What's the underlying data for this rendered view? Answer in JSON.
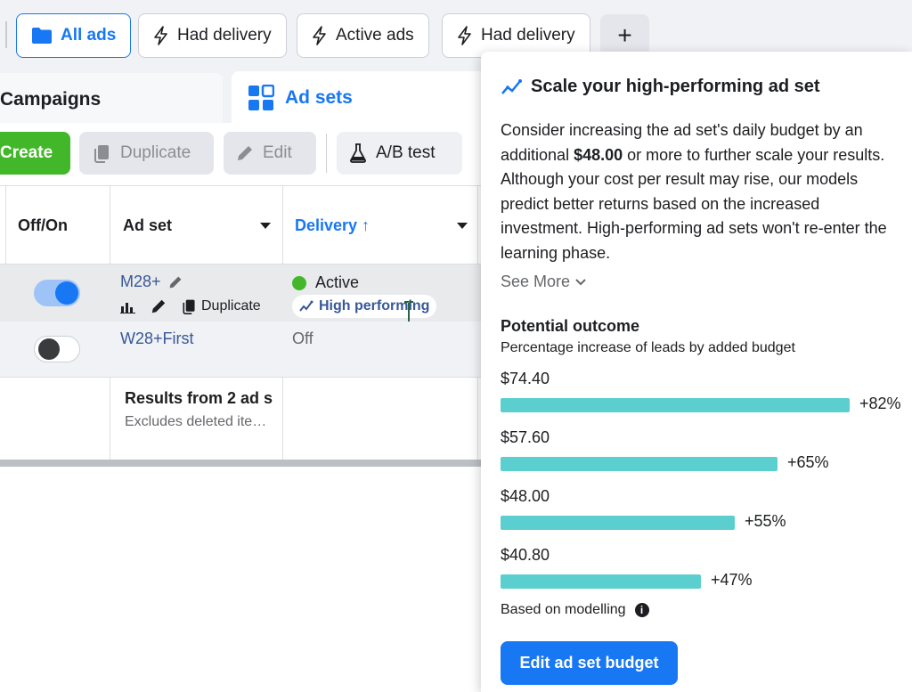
{
  "filter_chips": [
    "All ads",
    "Had delivery",
    "Active ads",
    "Had delivery"
  ],
  "add_filter": "+",
  "tabs": {
    "campaigns": "Campaigns",
    "ad_sets": "Ad sets"
  },
  "toolbar": {
    "create": "Create",
    "duplicate": "Duplicate",
    "edit": "Edit",
    "ab_test": "A/B test"
  },
  "table": {
    "headers": {
      "toggle": "Off/On",
      "ad_set": "Ad set",
      "delivery": "Delivery ↑"
    },
    "rows": [
      {
        "name": "M28+",
        "on": true,
        "delivery": "Active",
        "badge": "High performing",
        "duplicate": "Duplicate"
      },
      {
        "name": "W28+First",
        "on": false,
        "delivery": "Off"
      }
    ],
    "summary": {
      "title": "Results from 2 ad s",
      "subtitle": "Excludes deleted ite…"
    }
  },
  "panel": {
    "title": "Scale your high-performing ad set",
    "body_pre": "Consider increasing the ad set's daily budget by an additional ",
    "body_amount": "$48.00",
    "body_post": " or more to further scale your results. Although your cost per result may rise, our models predict better returns based on the increased investment. High-performing ad sets won't re-enter the learning phase.",
    "see_more": "See More",
    "outcome_title": "Potential outcome",
    "outcome_subtitle": "Percentage increase of leads by added budget",
    "bars": [
      {
        "budget": "$74.40",
        "increase": "+82%",
        "pct": 82
      },
      {
        "budget": "$57.60",
        "increase": "+65%",
        "pct": 65
      },
      {
        "budget": "$48.00",
        "increase": "+55%",
        "pct": 55
      },
      {
        "budget": "$40.80",
        "increase": "+47%",
        "pct": 47
      }
    ],
    "based_on": "Based on modelling",
    "cta": "Edit ad set budget"
  },
  "colors": {
    "accent": "#1877f2",
    "create": "#42b72a",
    "bar": "#5bcfcf",
    "active_dot": "#42b72a"
  }
}
